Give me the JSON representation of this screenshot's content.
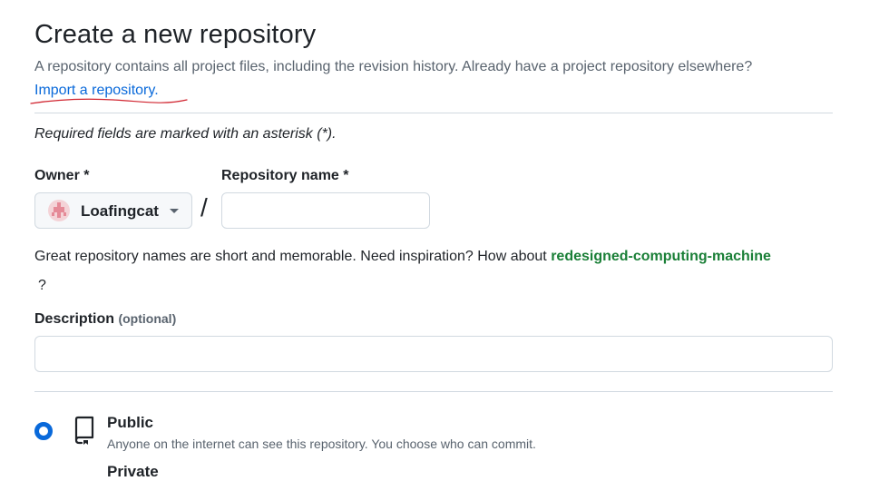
{
  "header": {
    "title": "Create a new repository",
    "subtitle": "A repository contains all project files, including the revision history. Already have a project repository elsewhere?",
    "import_link": "Import a repository."
  },
  "form": {
    "required_note": "Required fields are marked with an asterisk (*).",
    "owner_label": "Owner *",
    "owner_value": "Loafingcat",
    "slash": "/",
    "repo_name_label": "Repository name *",
    "repo_name_value": "",
    "hint_text": "Great repository names are short and memorable. Need inspiration? How about",
    "hint_suggestion": "redesigned-computing-machine",
    "hint_end": "?",
    "description_label": "Description",
    "description_optional": "(optional)",
    "description_value": ""
  },
  "visibility": {
    "public_label": "Public",
    "public_desc": "Anyone on the internet can see this repository. You choose who can commit.",
    "private_label": "Private"
  },
  "colors": {
    "link": "#0969da",
    "suggestion": "#1a7f37",
    "annotation_underline": "#d1242f"
  }
}
